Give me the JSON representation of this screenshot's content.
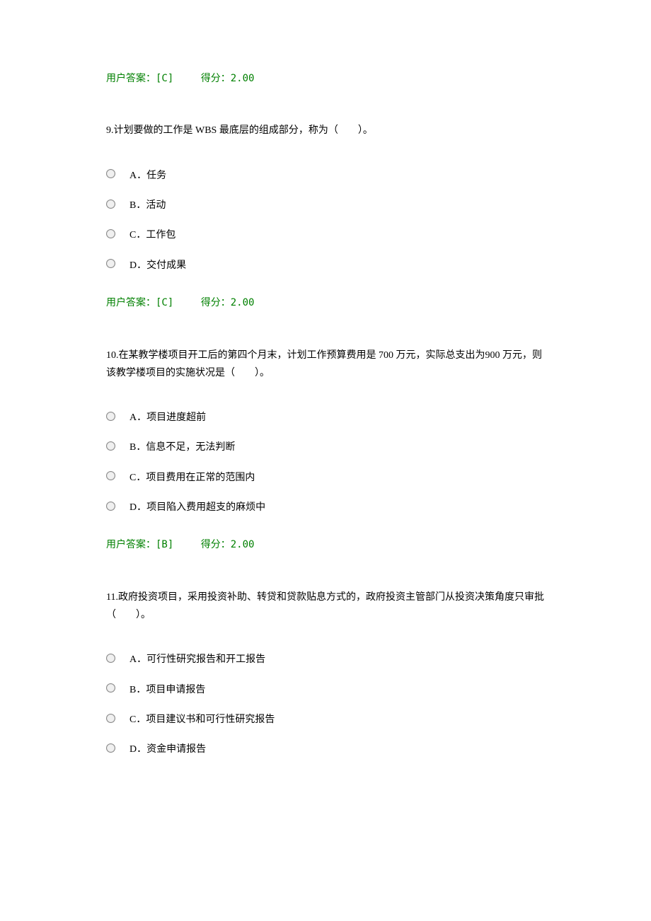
{
  "answer_prefix": "用户答案：",
  "score_prefix": "得分：",
  "q8": {
    "answer": "[C]",
    "score": "2.00"
  },
  "q9": {
    "text": "9.计划要做的工作是 WBS 最底层的组成部分，称为（　　）。",
    "options": {
      "a": "A．任务",
      "b": "B．活动",
      "c": "C．工作包",
      "d": "D．交付成果"
    },
    "answer": "[C]",
    "score": "2.00"
  },
  "q10": {
    "text": "10.在某教学楼项目开工后的第四个月末，计划工作预算费用是 700 万元，实际总支出为900 万元，则该教学楼项目的实施状况是（　　）。",
    "options": {
      "a": "A．项目进度超前",
      "b": "B．信息不足，无法判断",
      "c": "C．项目费用在正常的范围内",
      "d": "D．项目陷入费用超支的麻烦中"
    },
    "answer": "[B]",
    "score": "2.00"
  },
  "q11": {
    "text": "11.政府投资项目，采用投资补助、转贷和贷款贴息方式的，政府投资主管部门从投资决策角度只审批（　　）。",
    "options": {
      "a": "A．可行性研究报告和开工报告",
      "b": "B．项目申请报告",
      "c": "C．项目建议书和可行性研究报告",
      "d": "D．资金申请报告"
    }
  }
}
